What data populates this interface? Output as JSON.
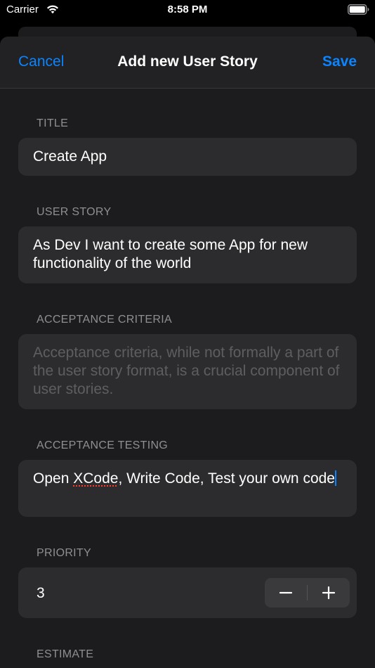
{
  "status_bar": {
    "carrier": "Carrier",
    "time": "8:58 PM",
    "wifi_icon": "wifi-icon",
    "battery_icon": "battery-icon"
  },
  "nav": {
    "cancel_label": "Cancel",
    "title": "Add new User Story",
    "save_label": "Save"
  },
  "form": {
    "title": {
      "header": "TITLE",
      "value": "Create App"
    },
    "user_story": {
      "header": "USER STORY",
      "value": "As Dev I want to create some App for new functionality of the world"
    },
    "acceptance_criteria": {
      "header": "ACCEPTANCE CRITERIA",
      "value": "",
      "placeholder": "Acceptance criteria, while not formally a part of the user story format, is a crucial component of user stories."
    },
    "acceptance_testing": {
      "header": "ACCEPTANCE TESTING",
      "value_before": "Open ",
      "value_misspelled": "XCode",
      "value_after": ", Write Code, Test your own code"
    },
    "priority": {
      "header": "PRIORITY",
      "value": "3",
      "decrement_icon": "minus-icon",
      "increment_icon": "plus-icon"
    },
    "estimate": {
      "header": "ESTIMATE"
    }
  },
  "colors": {
    "accent": "#0a84ff",
    "background": "#1c1c1e",
    "field_background": "#2c2c2e",
    "section_header": "#8e8e93",
    "placeholder": "#5e5e62",
    "spellcheck_underline": "#ff3b30"
  }
}
